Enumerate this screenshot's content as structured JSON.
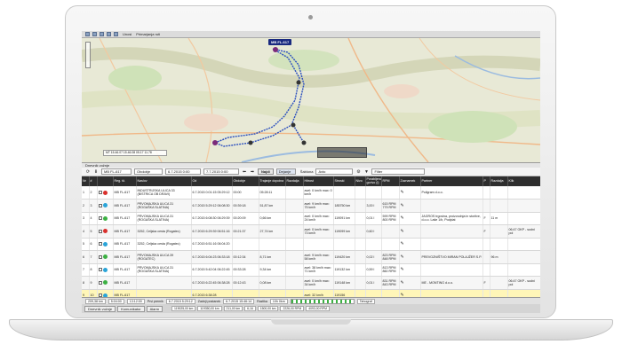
{
  "map": {
    "toolbar_links": [
      "Unosi",
      "Primarjanja ruti"
    ],
    "vehicle_label": "MB FL-617",
    "info_text": "MT 15.46.07 15.46.08 05.17 11.78"
  },
  "panel": {
    "title": "Dnevnik vožnje",
    "vehicle_select": "MB FL-617",
    "period_select": "Obdobje",
    "date_from": "6.7.2015 0:00",
    "date_to": "7.7.2015 0:00",
    "find_button": "Najdi",
    "tab_trips": "Dejanje",
    "template_label": "Šablona",
    "template_value": "Avto",
    "filter_label": "Filter"
  },
  "table": {
    "headers": [
      "Nr",
      "#",
      "",
      "Reg. št.",
      "Naslov",
      "Od",
      "Obdobje",
      "Trajanje dopolna",
      "Razdalja",
      "Hitrost",
      "Stroski",
      "Nivo",
      "Porabljeno gorivo (l)",
      "RPM",
      "Zaznamek",
      "Partner",
      "P",
      "Razdalja",
      "Klik"
    ],
    "rows": [
      {
        "nr": "1",
        "n": "2",
        "reg": "MB FL-617",
        "addr": "INDUSTRIJSKA ULICA 33 (BISTRICA OB DRAVI)",
        "od": "6.7.2015 0:01:15 05:29:12",
        "obd": "00:00",
        "traj": "05:28:11",
        "raz": "",
        "hitrost": "avel: 0 km/h max: 0 km/h",
        "str": "",
        "niv": "",
        "gor": "",
        "rpm": "",
        "zazn": "",
        "partner": "Poligram d.o.o.",
        "p": "",
        "razd": "",
        "klik": ""
      },
      {
        "nr": "2",
        "n": "3",
        "reg": "MB FL-617",
        "addr": "PRVOMAJSKA ULICA 31 (ROGAŠKA SLATINA)",
        "od": "6.7.2015 5:29:12 06:08:30",
        "obd": "00:39:18",
        "traj": "51,87 km",
        "raz": "",
        "hitrost": "avel: 9 km/h max: 75 km/h",
        "str": "185750 km",
        "niv": "",
        "gor": "3,00 l",
        "rpm": "615 RPM 779 RPM",
        "zazn": "",
        "partner": "",
        "p": "",
        "razd": "",
        "klik": ""
      },
      {
        "nr": "3",
        "n": "4",
        "reg": "MB FL-617",
        "addr": "PRVOMAJSKA ULICA 31 (ROGAŠKA SLATINA)",
        "od": "6.7.2015 6:08:30 06:29:39",
        "obd": "00:20:09",
        "traj": "0,66 km",
        "raz": "",
        "hitrost": "avel: 0 km/h max: 24 km/h",
        "str": "119091 km",
        "niv": "",
        "gor": "0,01 l",
        "rpm": "599 RPM 800 RPM",
        "zazn": "",
        "partner": "JAGROS trgovina, proizvodnja in storitve, d.o.o. Laše 1/b, Podplat",
        "p": "F",
        "razd": "11 m",
        "klik": ""
      },
      {
        "nr": "4",
        "n": "5",
        "reg": "MB FL-617",
        "addr": "3252, Celjska cesta (Rogatec)",
        "od": "6.7.2015 6:29:39 06:51:16",
        "obd": "00:21:37",
        "traj": "27,74 km",
        "raz": "",
        "hitrost": "avel: 0 km/h max: 73 km/h",
        "str": "119099 km",
        "niv": "",
        "gor": "0,60 l",
        "rpm": "",
        "zazn": "",
        "partner": "",
        "p": "F",
        "razd": "",
        "klik": "06:47 OKP - sodni pol"
      },
      {
        "nr": "5",
        "n": "6",
        "reg": "MB FL-617",
        "addr": "3252, Celjska cesta (Rogatec)",
        "od": "6.7.2015 6:51:16 06:04:20",
        "obd": "",
        "traj": "",
        "raz": "",
        "hitrost": "",
        "str": "",
        "niv": "",
        "gor": "",
        "rpm": "",
        "zazn": "",
        "partner": "",
        "p": "",
        "razd": "",
        "klik": ""
      },
      {
        "nr": "6",
        "n": "7",
        "reg": "MB FL-617",
        "addr": "PRVOMAJSKA ULICA 39 (ROGATEC)",
        "od": "6.7.2015 6:04:23 06:33:18",
        "obd": "00:12:34",
        "traj": "8,71 km",
        "raz": "",
        "hitrost": "avel: 9 km/h max: 58 km/h",
        "str": "119420 km",
        "niv": "",
        "gor": "0,02 l",
        "rpm": "823 RPM 848 RPM",
        "zazn": "",
        "partner": "PREVOZNIŠTVO MIRAN POLAJŽER S.P.",
        "p": "",
        "razd": "96 m",
        "klik": ""
      },
      {
        "nr": "7",
        "n": "8",
        "reg": "MB FL-617",
        "addr": "PRVOMAJSKA ULICA 31 (ROGAŠKA SLATINA)",
        "od": "6.7.2015 5:42:04 06:22:45",
        "obd": "00:33:28",
        "traj": "9,34 km",
        "raz": "",
        "hitrost": "avel: 38 km/h max: 71 km/h",
        "str": "119132 km",
        "niv": "",
        "gor": "0,59 l",
        "rpm": "813 RPM 860 RPM",
        "zazn": "",
        "partner": "",
        "p": "",
        "razd": "",
        "klik": ""
      },
      {
        "nr": "8",
        "n": "9",
        "reg": "MB FL-617",
        "addr": "",
        "od": "6.7.2015 6:22:45 06:38:28",
        "obd": "00:12:43",
        "traj": "0,08 km",
        "raz": "",
        "hitrost": "avel: 0 km/h max: 34 km/h",
        "str": "119148 km",
        "niv": "",
        "gor": "0,01 l",
        "rpm": "831 RPM 843 RPM",
        "zazn": "",
        "partner": "ME - MONTING d.o.o.",
        "p": "F",
        "razd": "",
        "klik": "06:47 OKP - sodni pol"
      },
      {
        "nr": "9",
        "n": "10",
        "reg": "MB FL-617",
        "addr": "",
        "od": "6.7.2015 6:38:28",
        "obd": "",
        "traj": "",
        "raz": "",
        "hitrost": "avel: 32 km/h",
        "str": "119156",
        "niv": "",
        "gor": "",
        "rpm": "",
        "zazn": "",
        "partner": "",
        "p": "",
        "razd": "",
        "klik": ""
      }
    ]
  },
  "status": {
    "distance": "209,38 km",
    "time1": "5:04:00",
    "time2": "13:12:00",
    "label_start": "Prvi premik",
    "start_value": "6.7.2015 5:29:12",
    "label_end": "Zadnji postanek",
    "end_value": "6.7.2015 15:46:14",
    "label_speed": "Razlika",
    "speed_value": "10h 0km",
    "tachograph": "Tahograf"
  },
  "status2": {
    "v1": "119025,00 km",
    "v2": "119350,00 km",
    "v3": "211,00 km",
    "v4": "6,16",
    "v5": "1500,00 km",
    "v6": "2226,00 RPM",
    "v7": "4093,00 RPM"
  },
  "tabs": [
    "Dnevnik vožnje",
    "Komunikator",
    "Alarm"
  ]
}
